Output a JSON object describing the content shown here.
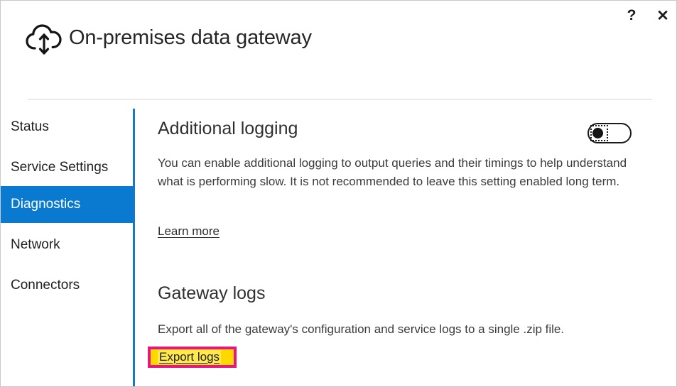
{
  "window": {
    "title": "On-premises data gateway",
    "app_icon": "cloud-updown-arrow-icon",
    "help_label": "?",
    "close_label": "✕",
    "accent_color": "#0a7ad0",
    "divider_color": "#1878c8"
  },
  "sidebar": {
    "items": [
      {
        "label": "Status",
        "selected": false
      },
      {
        "label": "Service Settings",
        "selected": false
      },
      {
        "label": "Diagnostics",
        "selected": true
      },
      {
        "label": "Network",
        "selected": false
      },
      {
        "label": "Connectors",
        "selected": false
      }
    ]
  },
  "content": {
    "additional_logging": {
      "heading": "Additional logging",
      "description": "You can enable additional logging to output queries and their timings to help understand what is performing slow. It is not recommended to leave this setting enabled long term.",
      "learn_more_label": "Learn more",
      "toggle_state": "off"
    },
    "gateway_logs": {
      "heading": "Gateway logs",
      "description": "Export all of the gateway's configuration and service logs to a single .zip file.",
      "export_logs_label": "Export logs"
    }
  },
  "annotation": {
    "target": "Export logs",
    "box_color": "#e6177f",
    "highlight_color": "#ffd800"
  }
}
